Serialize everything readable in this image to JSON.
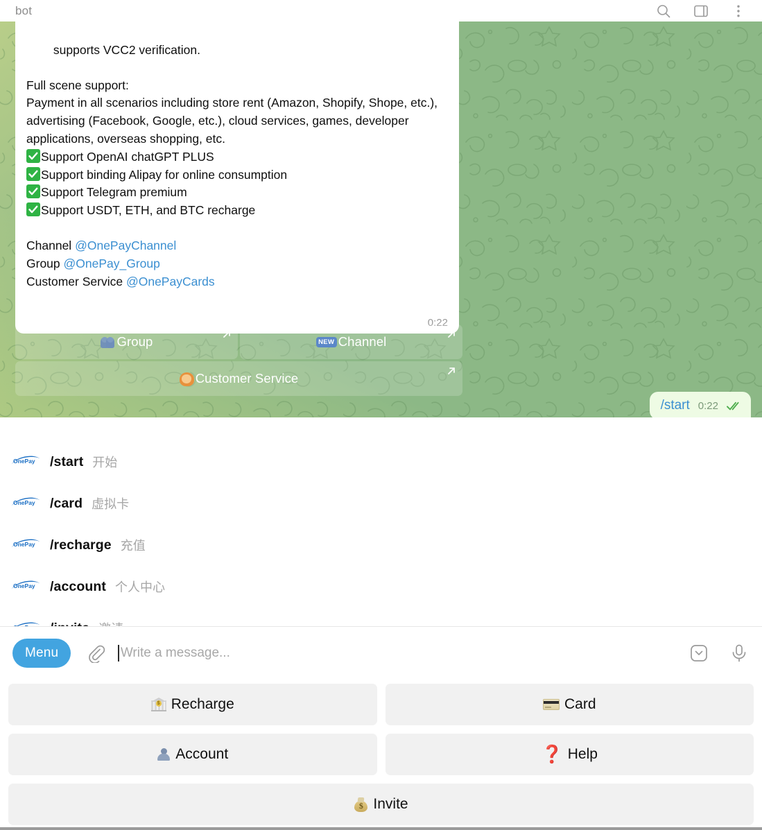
{
  "header": {
    "title": "bot",
    "icons": [
      "search-icon",
      "sidebar-icon",
      "more-vertical-icon"
    ]
  },
  "message": {
    "line_top": "supports VCC2 verification.",
    "scene_title": "Full scene support:",
    "scene_body": "Payment in all scenarios including store rent (Amazon, Shopify, Shope, etc.), advertising (Facebook, Google, etc.), cloud services, games, developer applications, overseas shopping, etc.",
    "features": [
      "Support OpenAI chatGPT PLUS",
      "Support binding Alipay for online consumption",
      "Support Telegram premium",
      "Support USDT, ETH, and BTC recharge"
    ],
    "contacts": [
      {
        "label": "Channel",
        "handle": "@OnePayChannel"
      },
      {
        "label": "Group",
        "handle": "@OnePay_Group"
      },
      {
        "label": "Customer Service",
        "handle": "@OnePayCards"
      }
    ],
    "time": "0:22"
  },
  "inline_keyboard": {
    "rows": [
      [
        {
          "label": "Group",
          "icon": "busts-emoji"
        },
        {
          "label": "Channel",
          "icon": "new-badge-emoji"
        }
      ],
      [
        {
          "label": "Customer Service",
          "icon": "woman-emoji"
        }
      ]
    ]
  },
  "outgoing_message": {
    "text": "/start",
    "time": "0:22",
    "status": "read-double-check"
  },
  "command_suggestions": [
    {
      "command": "/start",
      "description": "开始",
      "avatar": "onepay-logo"
    },
    {
      "command": "/card",
      "description": "虚拟卡",
      "avatar": "onepay-logo"
    },
    {
      "command": "/recharge",
      "description": "充值",
      "avatar": "onepay-logo"
    },
    {
      "command": "/account",
      "description": "个人中心",
      "avatar": "onepay-logo"
    },
    {
      "command": "/invite",
      "description": "邀请",
      "avatar": "onepay-logo"
    }
  ],
  "composer": {
    "menu_label": "Menu",
    "attach_icon": "paperclip-icon",
    "placeholder": "Write a message...",
    "value": "",
    "right_icons": [
      "keyboard-collapse-icon",
      "microphone-icon"
    ]
  },
  "reply_keyboard": {
    "rows": [
      [
        {
          "label": "Recharge",
          "icon": "bank-emoji"
        },
        {
          "label": "Card",
          "icon": "credit-card-emoji"
        }
      ],
      [
        {
          "label": "Account",
          "icon": "bust-emoji"
        },
        {
          "label": "Help",
          "icon": "red-question-mark-emoji"
        }
      ],
      [
        {
          "label": "Invite",
          "icon": "money-bag-emoji"
        }
      ]
    ]
  },
  "colors": {
    "chat_background": "#8cb886",
    "accent_blue": "#42a4e0",
    "link_blue": "#3b8fd1",
    "outgoing_bubble": "#eefbe4",
    "check_green": "#4caf50",
    "tick_green": "#4fae4e",
    "keyboard_button": "#f1f1f1",
    "help_red": "#e0152b"
  }
}
